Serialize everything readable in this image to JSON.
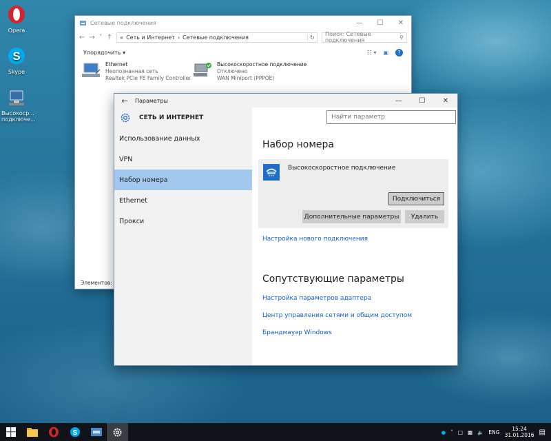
{
  "desktop": {
    "icons": [
      {
        "label": "Opera"
      },
      {
        "label": "Skype"
      },
      {
        "label": "Высокоср... подключе..."
      }
    ]
  },
  "explorer": {
    "title": "Сетевые подключения",
    "breadcrumb": [
      "«",
      "Сеть и Интернет",
      "›",
      "Сетевые подключения"
    ],
    "search_placeholder": "Поиск: Сетевые подключения",
    "toolbar": {
      "organize_label": "Упорядочить"
    },
    "items": [
      {
        "name": "Ethernet",
        "status": "Неопознанная сеть",
        "device": "Realtek PCIe FE Family Controller"
      },
      {
        "name": "Высокоскоростное подключение",
        "status": "Отключено",
        "device": "WAN Miniport (PPPOE)"
      }
    ],
    "status_bar": "Элементов: 2"
  },
  "settings": {
    "title": "Параметры",
    "header": "СЕТЬ И ИНТЕРНЕТ",
    "search_placeholder": "Найти параметр",
    "nav": [
      {
        "label": "Использование данных",
        "active": false
      },
      {
        "label": "VPN",
        "active": false
      },
      {
        "label": "Набор номера",
        "active": true
      },
      {
        "label": "Ethernet",
        "active": false
      },
      {
        "label": "Прокси",
        "active": false
      }
    ],
    "page_title": "Набор номера",
    "connection": {
      "name": "Высокоскоростное подключение"
    },
    "buttons": {
      "connect": "Подключиться",
      "advanced": "Дополнительные параметры",
      "delete": "Удалить"
    },
    "new_connection_link": "Настройка нового подключения",
    "related_title": "Сопутствующие параметры",
    "related_links": [
      "Настройка параметров адаптера",
      "Центр управления сетями и общим доступом",
      "Брандмауэр Windows"
    ]
  },
  "taskbar": {
    "language": "ENG",
    "time": "15:24",
    "date": "31.01.2016",
    "accent": "#a2c8ef"
  }
}
